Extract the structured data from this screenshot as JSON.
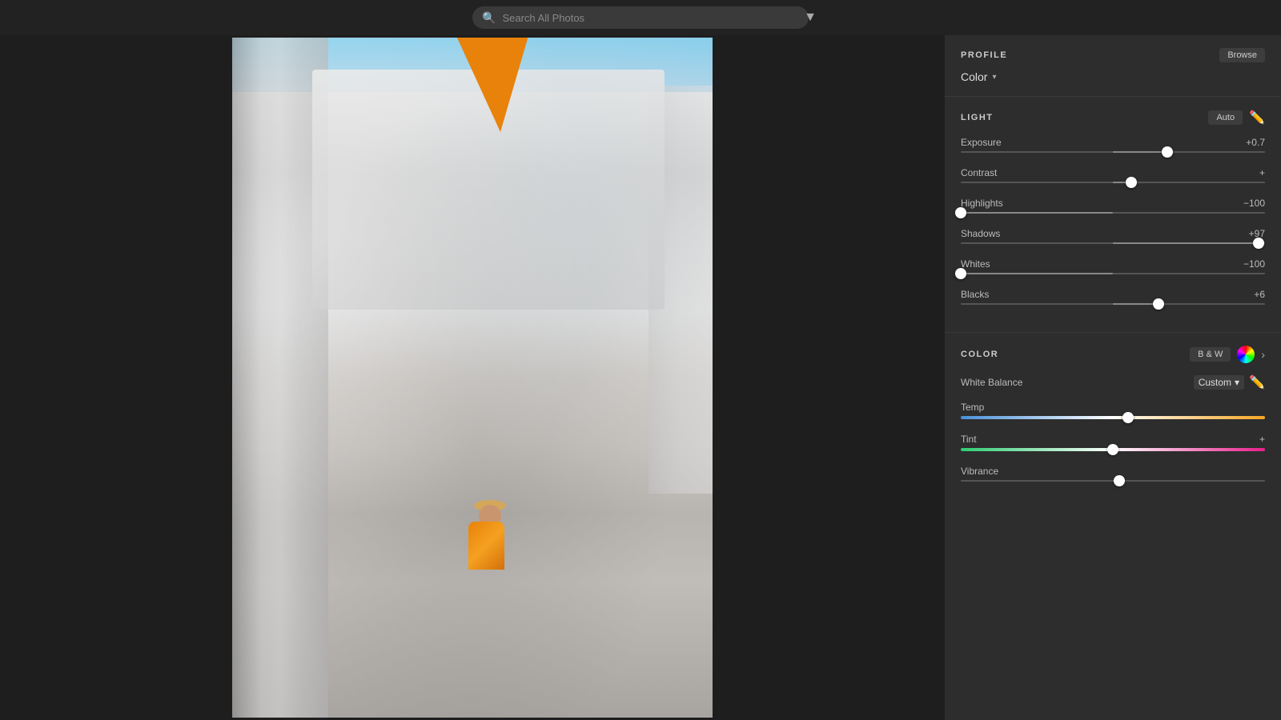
{
  "topbar": {
    "search_placeholder": "Search All Photos"
  },
  "profile": {
    "title": "PROFILE",
    "browse_label": "Browse",
    "color_label": "Color"
  },
  "light": {
    "title": "LIGHT",
    "auto_label": "Auto",
    "sliders": [
      {
        "id": "exposure",
        "label": "Exposure",
        "value": "+0.7",
        "percent": 68
      },
      {
        "id": "contrast",
        "label": "Contrast",
        "value": "+",
        "percent": 56
      },
      {
        "id": "highlights",
        "label": "Highlights",
        "value": "−100",
        "percent": 0
      },
      {
        "id": "shadows",
        "label": "Shadows",
        "value": "+97",
        "percent": 98
      },
      {
        "id": "whites",
        "label": "Whites",
        "value": "−100",
        "percent": 0
      },
      {
        "id": "blacks",
        "label": "Blacks",
        "value": "+6",
        "percent": 65
      }
    ]
  },
  "color": {
    "title": "COLOR",
    "bw_label": "B & W",
    "white_balance_label": "White Balance",
    "white_balance_value": "Custom",
    "sliders": [
      {
        "id": "temp",
        "label": "Temp",
        "value": "",
        "percent": 55,
        "type": "temp"
      },
      {
        "id": "tint",
        "label": "Tint",
        "value": "+",
        "percent": 50,
        "type": "tint"
      },
      {
        "id": "vibrance",
        "label": "Vibrance",
        "value": "",
        "percent": 52,
        "type": "plain"
      }
    ]
  }
}
